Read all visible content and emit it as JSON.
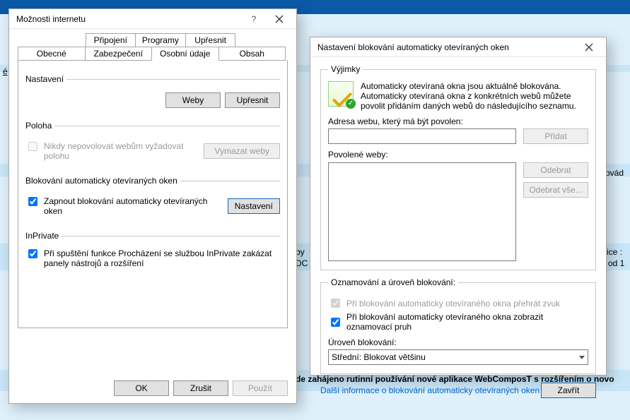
{
  "bg": {
    "text_right1": "ice :",
    "text_right2": "od 1",
    "text_left": "é",
    "text_mid": "ovád",
    "text_row_b": "by",
    "text_row_d": "DC",
    "bottom": "de zahájeno rutinní používání nové aplikace WebComposT s rozšířením o novo"
  },
  "internet_options": {
    "title": "Možnosti internetu",
    "tabs_top": [
      "Připojení",
      "Programy",
      "Upřesnit"
    ],
    "tabs_bottom": [
      "Obecné",
      "Zabezpečení",
      "Osobní údaje",
      "Obsah"
    ],
    "settings_legend": "Nastavení",
    "btn_sites": "Weby",
    "btn_advanced": "Upřesnit",
    "location_legend": "Poloha",
    "chk_never_allow": "Nikdy nepovolovat webům vyžadovat polohu",
    "btn_clear_sites": "Vymazat weby",
    "popup_legend": "Blokování automaticky otevíraných oken",
    "chk_enable_popup": "Zapnout blokování automaticky otevíraných oken",
    "btn_popup_settings": "Nastavení",
    "inprivate_legend": "InPrivate",
    "chk_inprivate": "Při spuštění funkce Procházení se službou InPrivate zakázat panely nástrojů a rozšíření",
    "btn_ok": "OK",
    "btn_cancel": "Zrušit",
    "btn_apply": "Použít"
  },
  "popup_settings": {
    "title": "Nastavení blokování automaticky otevíraných oken",
    "exceptions_legend": "Výjimky",
    "desc": "Automaticky otevíraná okna jsou aktuálně blokována. Automaticky otevíraná okna z konkrétních webů můžete povolit přidáním daných webů do následujícího seznamu.",
    "addr_label": "Adresa webu, který má být povolen:",
    "btn_add": "Přidat",
    "allowed_label": "Povolené weby:",
    "btn_remove": "Odebrat",
    "btn_remove_all": "Odebrat vše...",
    "notify_legend": "Oznamování a úroveň blokování:",
    "chk_sound": "Při blokování automaticky otevíraného okna přehrát zvuk",
    "chk_infobar": "Při blokování automaticky otevíraného okna zobrazit oznamovací pruh",
    "level_label": "Úroveň blokování:",
    "level_value": "Střední: Blokovat většinu",
    "more_info": "Další informace o blokování automaticky otevíraných oken",
    "btn_close": "Zavřít"
  }
}
